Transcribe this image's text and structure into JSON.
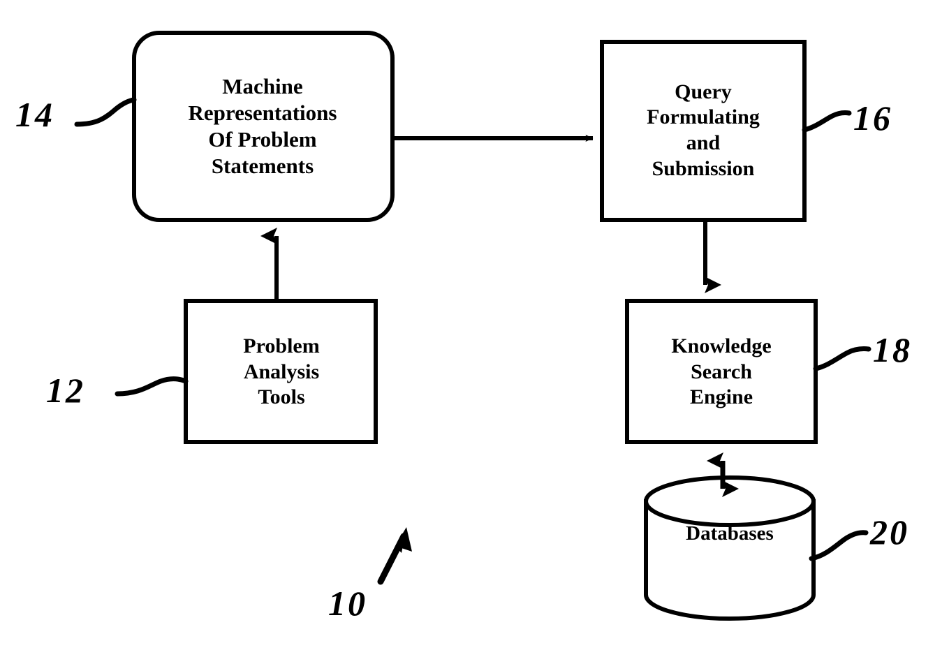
{
  "figure": {
    "type": "patent-block-diagram",
    "background_color": "#ffffff",
    "line_color": "#000000",
    "system_reference": "10"
  },
  "nodes": {
    "machine_representations": {
      "label": "Machine\nRepresentations\nOf Problem\nStatements",
      "reference": "14",
      "shape": "rounded-rectangle"
    },
    "query_formulating": {
      "label": "Query\nFormulating\nand\nSubmission",
      "reference": "16",
      "shape": "rectangle"
    },
    "problem_analysis": {
      "label": "Problem\nAnalysis\nTools",
      "reference": "12",
      "shape": "rectangle"
    },
    "knowledge_search": {
      "label": "Knowledge\nSearch\nEngine",
      "reference": "18",
      "shape": "rectangle"
    },
    "databases": {
      "label": "Databases",
      "reference": "20",
      "shape": "cylinder"
    }
  },
  "references": {
    "ref_12": "12",
    "ref_14": "14",
    "ref_16": "16",
    "ref_18": "18",
    "ref_20": "20",
    "ref_10": "10"
  },
  "connectors": [
    {
      "name": "machine-representations-to-query",
      "from": "machine_representations",
      "to": "query_formulating",
      "direction": "right",
      "arrowheads": 1
    },
    {
      "name": "problem-analysis-to-machine-representations",
      "from": "problem_analysis",
      "to": "machine_representations",
      "direction": "up",
      "arrowheads": 1
    },
    {
      "name": "query-to-knowledge-search",
      "from": "query_formulating",
      "to": "knowledge_search",
      "direction": "down",
      "arrowheads": 1
    },
    {
      "name": "databases-to-knowledge-search",
      "from": "databases",
      "to": "knowledge_search",
      "direction": "bidirectional",
      "arrowheads": 2
    }
  ]
}
